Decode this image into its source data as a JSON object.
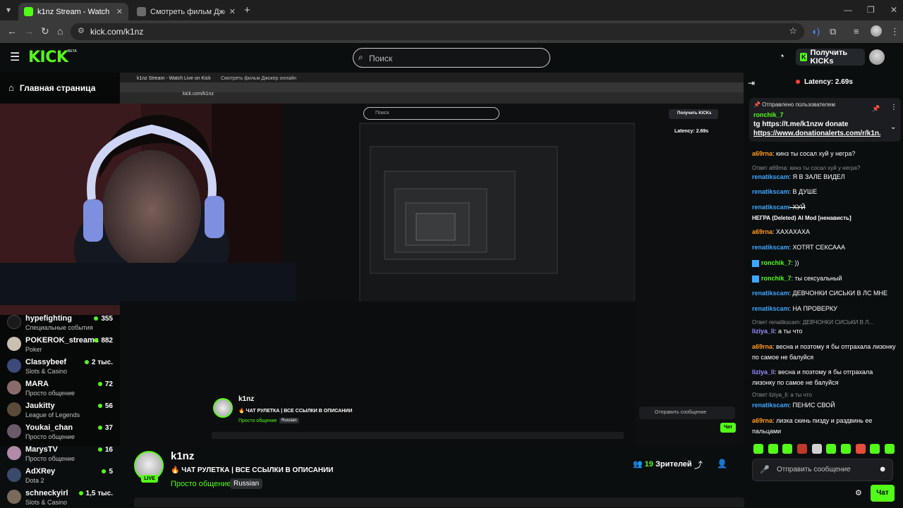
{
  "browser": {
    "tabs": [
      {
        "title": "k1nz Stream - Watch Live on Kick",
        "active": true
      },
      {
        "title": "Смотреть фильм Джокер онлайн",
        "active": false
      }
    ],
    "url": "kick.com/k1nz"
  },
  "header": {
    "logo": "KICK",
    "beta": "BETA",
    "search_placeholder": "Поиск",
    "get_kicks": "Получить KICKs"
  },
  "sidebar": {
    "home": "Главная страница",
    "channels": [
      {
        "name": "hypefighting",
        "category": "Специальные события",
        "viewers": "355"
      },
      {
        "name": "POKEROK_streams",
        "category": "Poker",
        "viewers": "882"
      },
      {
        "name": "Classybeef",
        "category": "Slots & Casino",
        "viewers": "2 тыс."
      },
      {
        "name": "MARA",
        "category": "Просто общение",
        "viewers": "72"
      },
      {
        "name": "Jaukitty",
        "category": "League of Legends",
        "viewers": "56"
      },
      {
        "name": "Youkai_chan",
        "category": "Просто общение",
        "viewers": "37"
      },
      {
        "name": "MarysTV",
        "category": "Просто общение",
        "viewers": "16"
      },
      {
        "name": "AdXRey",
        "category": "Dota 2",
        "viewers": "5"
      },
      {
        "name": "schneckyirl",
        "category": "Slots & Casino",
        "viewers": "1,5 тыс."
      }
    ]
  },
  "stream": {
    "name": "k1nz",
    "live": "LIVE",
    "title": "🔥 ЧАТ РУЛЕТКА | ВСЕ ССЫЛКИ В ОПИСАНИИ",
    "category": "Просто общение",
    "language": "Russian",
    "viewers_count": "19",
    "viewers_label": "Зрителей"
  },
  "chat": {
    "latency": "Latency: 2.69s",
    "pinned": {
      "header": "Отправлено пользователем",
      "user": "ronchik_7",
      "line1": "tg https://t.me/k1nzw donate",
      "line2": "https://www.donationalerts.com/r/k1n..."
    },
    "messages": [
      {
        "user": "a69rna",
        "color": "#ff9a1f",
        "text": ": кинз ты сосал хуй у негра?"
      },
      {
        "reply": "Ответ a69rna: кинз ты сосал хуй у негра?"
      },
      {
        "user": "renatikscam",
        "color": "#3ea6ff",
        "text": ": Я В ЗАЛЕ ВИДЕЛ"
      },
      {
        "user": "renatikscam",
        "color": "#3ea6ff",
        "text": ": В ДУШЕ"
      },
      {
        "user": "renatikscam",
        "color": "#3ea6ff",
        "text": ": ХУЙ"
      },
      {
        "user": "НЕГРА (Deleted)",
        "color": "#ffffff",
        "text": " AI Mod [ненависть]"
      },
      {
        "user": "a69rna",
        "color": "#ff9a1f",
        "text": ": ХАХАХАХА"
      },
      {
        "user": "renatikscam",
        "color": "#3ea6ff",
        "text": ": ХОТЯТ СЕКСААА"
      },
      {
        "user": "ronchik_7",
        "color": "#53fc18",
        "text": ": ))"
      },
      {
        "user": "ronchik_7",
        "color": "#53fc18",
        "text": ": ты сексуальный"
      },
      {
        "user": "renatikscam",
        "color": "#3ea6ff",
        "text": ": ДЕВЧОНКИ СИСЬКИ В ЛС МНЕ"
      },
      {
        "user": "renatikscam",
        "color": "#3ea6ff",
        "text": ": НА ПРОВЕРКУ"
      },
      {
        "reply": "Ответ renatikscam: ДЕВЧОНКИ СИСЬКИ В Л..."
      },
      {
        "user": "liziya_li",
        "color": "#9b8cff",
        "text": ": а ты что"
      },
      {
        "user": "a69rna",
        "color": "#ff9a1f",
        "text": ": весна и поэтому я бы отграхала лизонку по самое не балуйся"
      },
      {
        "user": "liziya_li",
        "color": "#9b8cff",
        "text": ": весна и поэтому я бы отграхала лизонку по самое не балуйся"
      },
      {
        "reply": "Ответ liziya_li: а ты что"
      },
      {
        "user": "renatikscam",
        "color": "#3ea6ff",
        "text": ": ПЕНИС СВОЙ"
      },
      {
        "user": "a69rna",
        "color": "#ff9a1f",
        "text": ": лизка скинь пизду и раздвинь ее пальцами"
      }
    ],
    "input_placeholder": "Отправить сообщение",
    "send": "Чат"
  }
}
